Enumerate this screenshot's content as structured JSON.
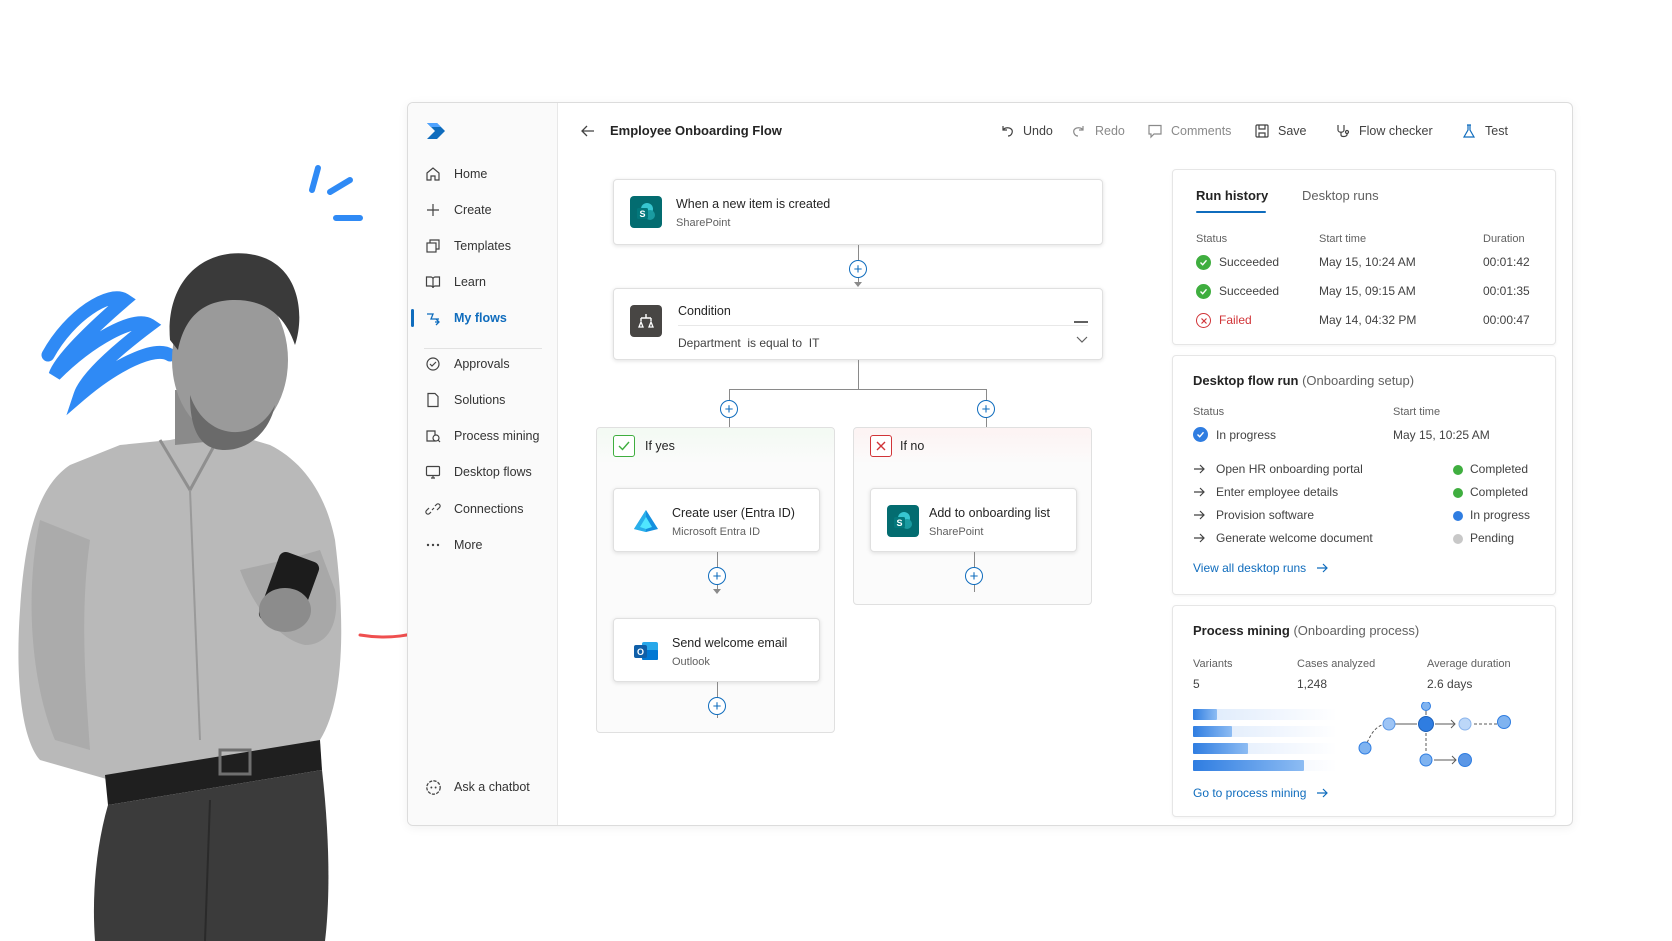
{
  "colors": {
    "brand": "#0f6cbd",
    "success": "#3fae3f",
    "failed": "#d13438",
    "in_progress": "#2f7de1",
    "pending": "#c8c8c8",
    "annotation_blue": "#2f8af5",
    "annotation_red": "#ef4f4f"
  },
  "sidebar": {
    "logo_icon": "power-automate-logo",
    "items": [
      {
        "label": "Home",
        "icon": "home-icon"
      },
      {
        "label": "Create",
        "icon": "plus-icon"
      },
      {
        "label": "Templates",
        "icon": "templates-icon"
      },
      {
        "label": "Learn",
        "icon": "book-icon"
      },
      {
        "label": "My flows",
        "icon": "flows-icon",
        "active": true
      },
      {
        "label": "Approvals",
        "icon": "approvals-icon"
      },
      {
        "label": "Solutions",
        "icon": "document-icon"
      },
      {
        "label": "Process mining",
        "icon": "process-mining-icon"
      },
      {
        "label": "Desktop flows",
        "icon": "monitor-icon"
      },
      {
        "label": "Connections",
        "icon": "link-icon"
      },
      {
        "label": "More",
        "icon": "ellipsis-icon"
      }
    ],
    "chatbot_label": "Ask a chatbot"
  },
  "topbar": {
    "title": "Employee Onboarding Flow",
    "undo": "Undo",
    "redo": "Redo",
    "comments": "Comments",
    "save": "Save",
    "flow_checker": "Flow checker",
    "test": "Test"
  },
  "flow": {
    "trigger": {
      "title": "When a new item is created",
      "subtitle": "SharePoint"
    },
    "condition": {
      "title": "Condition",
      "expression": "Department  is equal to  IT"
    },
    "yes_branch": {
      "label": "If yes",
      "actions": [
        {
          "title": "Create user (Entra ID)",
          "subtitle": "Microsoft Entra ID"
        },
        {
          "title": "Send welcome email",
          "subtitle": "Outlook"
        }
      ]
    },
    "no_branch": {
      "label": "If no",
      "actions": [
        {
          "title": "Add to onboarding list",
          "subtitle": "SharePoint"
        }
      ]
    }
  },
  "run_history": {
    "tabs": [
      "Run history",
      "Desktop runs"
    ],
    "columns": [
      "Status",
      "Start time",
      "Duration"
    ],
    "rows": [
      {
        "status": "Succeeded",
        "start": "May 15, 10:24 AM",
        "duration": "00:01:42",
        "state": "success"
      },
      {
        "status": "Succeeded",
        "start": "May 15, 09:15 AM",
        "duration": "00:01:35",
        "state": "success"
      },
      {
        "status": "Failed",
        "start": "May 14, 04:32 PM",
        "duration": "00:00:47",
        "state": "failed"
      }
    ]
  },
  "desktop_run": {
    "title": "Desktop flow run",
    "context": "(Onboarding setup)",
    "status_label": "Status",
    "status_value": "In progress",
    "start_label": "Start time",
    "start_value": "May 15, 10:25 AM",
    "steps": [
      {
        "name": "Open HR onboarding portal",
        "state": "Completed",
        "kind": "success"
      },
      {
        "name": "Enter employee details",
        "state": "Completed",
        "kind": "success"
      },
      {
        "name": "Provision software",
        "state": "In progress",
        "kind": "in_progress"
      },
      {
        "name": "Generate welcome document",
        "state": "Pending",
        "kind": "pending"
      }
    ],
    "link": "View all desktop runs"
  },
  "process_mining": {
    "title": "Process mining",
    "context": "(Onboarding process)",
    "stats": [
      {
        "label": "Variants",
        "value": "5"
      },
      {
        "label": "Cases analyzed",
        "value": "1,248"
      },
      {
        "label": "Average duration",
        "value": "2.6 days"
      }
    ],
    "variant_bars": [
      0.17,
      0.27,
      0.38,
      0.77
    ],
    "link": "Go to process mining"
  }
}
